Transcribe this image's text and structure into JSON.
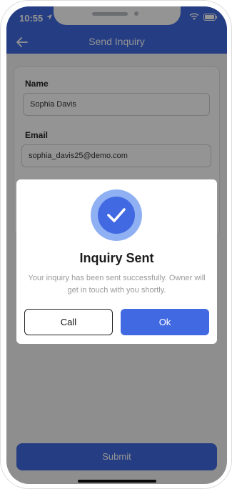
{
  "status_bar": {
    "time": "10:55"
  },
  "app_bar": {
    "title": "Send Inquiry"
  },
  "form": {
    "name_label": "Name",
    "name_value": "Sophia Davis",
    "email_label": "Email",
    "email_value": "sophia_davis25@demo.com"
  },
  "submit_label": "Submit",
  "dialog": {
    "title": "Inquiry Sent",
    "message": "Your inquiry has been sent successfully. Owner will get in touch with you shortly.",
    "call_label": "Call",
    "ok_label": "Ok"
  },
  "colors": {
    "accent": "#4169e1",
    "accent_light": "#8fb0f2"
  }
}
